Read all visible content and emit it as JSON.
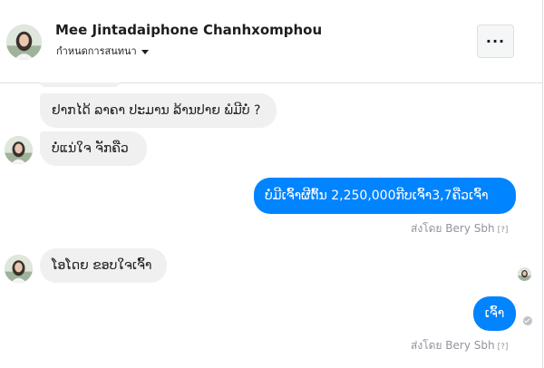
{
  "header": {
    "name": "Mee Jintadaiphone Chanhxomphou",
    "subtitle": "กำหนดการสนทนา",
    "more_label": "···"
  },
  "messages": [
    {
      "direction": "incoming",
      "text": "ຢາກໄດ້ ລາຄາ ປະມານ ລ້ານປາຍ ພໍມີບໍ່ ?"
    },
    {
      "direction": "incoming",
      "text": "ບໍ່ແນ່ໃຈ ຈັກຄືວ"
    },
    {
      "direction": "outgoing",
      "text": "ບໍ່ມີເຈົ້າຜີຕົ້ນ 2,250,000ກີບເຈົ້າ3,7ຄືວເຈົ້າ",
      "sent_by": "ส่งโดย Bery Sbh",
      "info": "[?]"
    },
    {
      "direction": "incoming",
      "text": "ໂອໂດຍ ຂອບໃຈເຈົ້າ"
    },
    {
      "direction": "outgoing",
      "text": "ເຈົ້າ",
      "sent_by": "ส่งโดย Bery Sbh",
      "info": "[?]"
    }
  ],
  "icons": {
    "avatar": "profile-photo",
    "more": "more-horizontal-icon",
    "seen": "seen-avatar-icon",
    "delivered": "delivered-check-icon"
  },
  "colors": {
    "outgoing_bubble": "#0084ff",
    "incoming_bubble": "#f1f0f0",
    "meta_text": "#90949c"
  }
}
